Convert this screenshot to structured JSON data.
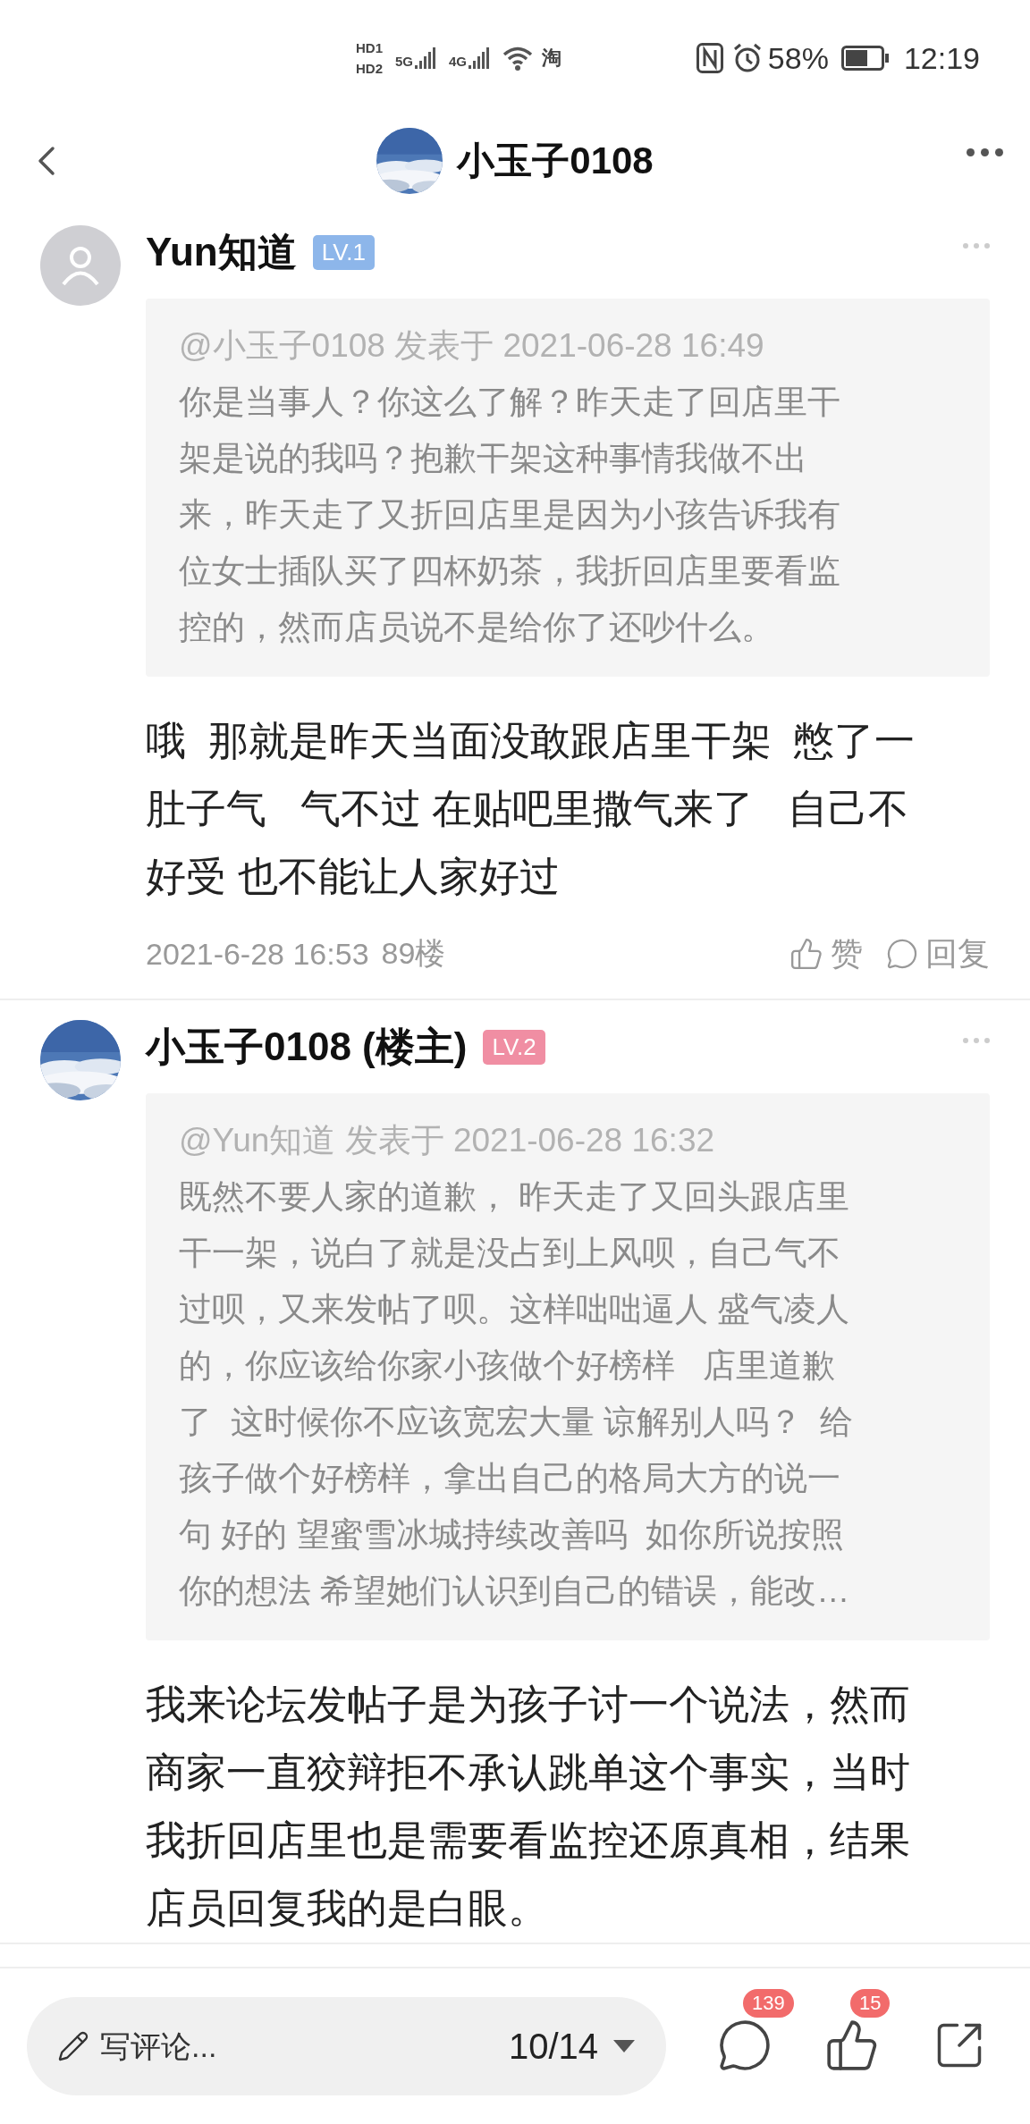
{
  "status_bar": {
    "sims": [
      {
        "label": "HD",
        "slot": "1"
      },
      {
        "label": "HD",
        "slot": "2"
      }
    ],
    "networks": [
      "5G",
      "4G"
    ],
    "notification": "淘",
    "battery": "58%",
    "time": "12:19"
  },
  "header": {
    "title": "小玉子0108"
  },
  "posts": [
    {
      "author": "Yun知道",
      "kind": "default",
      "level": "LV.1",
      "color": "#8db6ea",
      "quote": {
        "header": "@小玉子0108 发表于 2021-06-28 16:49",
        "lines": [
          "你是当事人？你这么了解？昨天走了回店里干",
          "架是说的我吗？抱歉干架这种事情我做不出",
          "来，昨天走了又折回店里是因为小孩告诉我有",
          "位女士插队买了四杯奶茶，我折回店里要看监",
          "控的，然而店员说不是给你了还吵什么。"
        ]
      },
      "body": [
        "哦  那就是昨天当面没敢跟店里干架  憋了一",
        "肚子气   气不过 在贴吧里撒气来了   自己不",
        "好受 也不能让人家好过"
      ],
      "meta": {
        "time": "2021-6-28 16:53",
        "floor": "89楼",
        "actions": [
          {
            "kind": "like",
            "label": "赞"
          },
          {
            "kind": "reply",
            "label": "回复"
          }
        ]
      }
    },
    {
      "author": "小玉子0108 (楼主)",
      "kind": "picture",
      "level": "LV.2",
      "color": "#f08ea3",
      "quote": {
        "header": "@Yun知道 发表于 2021-06-28 16:32",
        "lines": [
          "既然不要人家的道歉， 昨天走了又回头跟店里",
          "干一架，说白了就是没占到上风呗，自己气不",
          "过呗，又来发帖了呗。这样咄咄逼人 盛气凌人",
          "的，你应该给你家小孩做个好榜样   店里道歉",
          "了  这时候你不应该宽宏大量 谅解别人吗？  给",
          "孩子做个好榜样，拿出自己的格局大方的说一",
          "句 好的 望蜜雪冰城持续改善吗  如你所说按照",
          "你的想法 希望她们认识到自己的错误，能改…"
        ]
      },
      "body": [
        "我来论坛发帖子是为孩子讨一个说法，然而",
        "商家一直狡辩拒不承认跳单这个事实，当时",
        "我折回店里也是需要看监控还原真相，结果",
        "店员回复我的是白眼。"
      ]
    }
  ],
  "bottom_bar": {
    "comment_placeholder": "写评论...",
    "page": "10/14",
    "comments_count": "139",
    "likes_count": "15"
  }
}
